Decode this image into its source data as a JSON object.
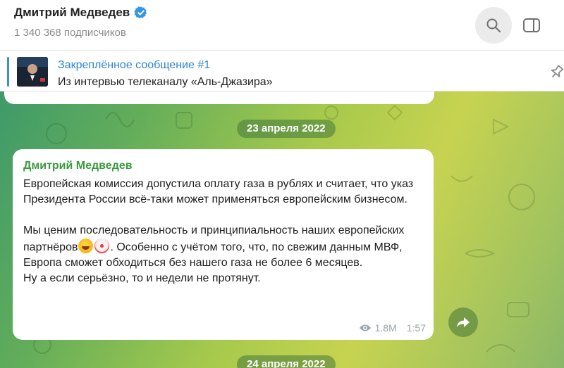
{
  "header": {
    "channel_name": "Дмитрий Медведев",
    "subscribers": "1 340 368 подписчиков",
    "verified_icon": "verified-badge-icon",
    "search_icon": "search-icon",
    "panel_icon": "side-panel-icon"
  },
  "pinned": {
    "title": "Закреплённое сообщение #1",
    "text": "Из интервью телеканалу «Аль-Джазира»",
    "pin_icon": "pin-icon"
  },
  "chat": {
    "dates": [
      "23 апреля 2022",
      "24 апреля 2022"
    ],
    "message": {
      "sender": "Дмитрий Медведев",
      "paragraph1": "Европейская комиссия допустила оплату газа в рублях и считает, что указ Президента России всё-таки может применяться европейским бизнесом.",
      "paragraph2_part1": "Мы ценим последовательность и принципиальность наших европейских партнёров",
      "paragraph2_part2": ". Особенно с учётом того, что, по свежим данным МВФ, Европа сможет обходиться без нашего газа не более 6 месяцев.",
      "paragraph3": "Ну а если серьёзно, то и недели не протянут.",
      "emojis": [
        "laughing-emoji",
        "clown-emoji"
      ],
      "views": "1.8M",
      "time": "1:57"
    },
    "share_icon": "share-icon"
  },
  "colors": {
    "accent_blue": "#2d86cf",
    "sender_green": "#3a9a3f",
    "meta_gray": "#9aa3a8"
  }
}
